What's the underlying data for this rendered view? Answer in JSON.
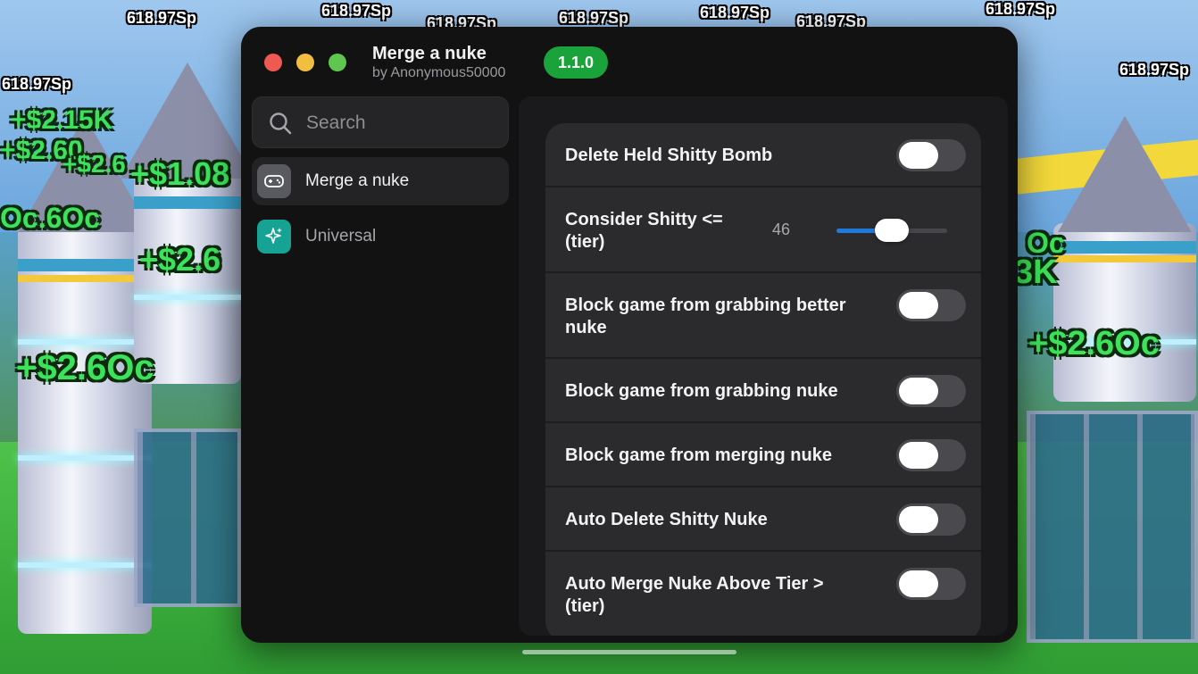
{
  "background_labels": {
    "sp_value": "618.97Sp",
    "money_a": "+$2.15K",
    "money_b": "+$2.60",
    "money_c": "+$2.6",
    "money_d": "+$1.08",
    "money_e": "Oc.6Oc",
    "money_f": "+$2.6",
    "money_g": "+$2.6Oc",
    "money_h": "+$2.6Oc",
    "money_i": "Oc",
    "money_j": "3K"
  },
  "window": {
    "title": "Merge a nuke",
    "subtitle": "by Anonymous50000",
    "version": "1.1.0",
    "controls": {
      "close_color": "#ee5a52",
      "minimize_color": "#f1be3f",
      "zoom_color": "#5fc650"
    }
  },
  "search": {
    "placeholder": "Search",
    "value": ""
  },
  "sidebar": {
    "items": [
      {
        "label": "Merge a nuke",
        "icon": "gamepad-icon",
        "active": true
      },
      {
        "label": "Universal",
        "icon": "sparkles-icon",
        "active": false
      }
    ]
  },
  "settings": [
    {
      "label": "Delete Held Shitty Bomb",
      "type": "toggle",
      "on": false
    },
    {
      "label_line1": "Consider Shitty <=",
      "label_line2": "(tier)",
      "type": "slider",
      "value": "46",
      "fill_fraction": 0.5
    },
    {
      "label_line1": "Block game from grabbing better",
      "label_line2": "nuke",
      "type": "toggle",
      "on": false
    },
    {
      "label": "Block game from grabbing nuke",
      "type": "toggle",
      "on": false
    },
    {
      "label": "Block game from merging nuke",
      "type": "toggle",
      "on": false
    },
    {
      "label": "Auto Delete Shitty Nuke",
      "type": "toggle",
      "on": false
    },
    {
      "label_line1": "Auto Merge Nuke Above Tier >",
      "label_line2": "(tier)",
      "type": "toggle",
      "on": false
    }
  ],
  "colors": {
    "accent": "#1f7ae0",
    "version_badge": "#1aa33b",
    "panel": "#121213"
  }
}
